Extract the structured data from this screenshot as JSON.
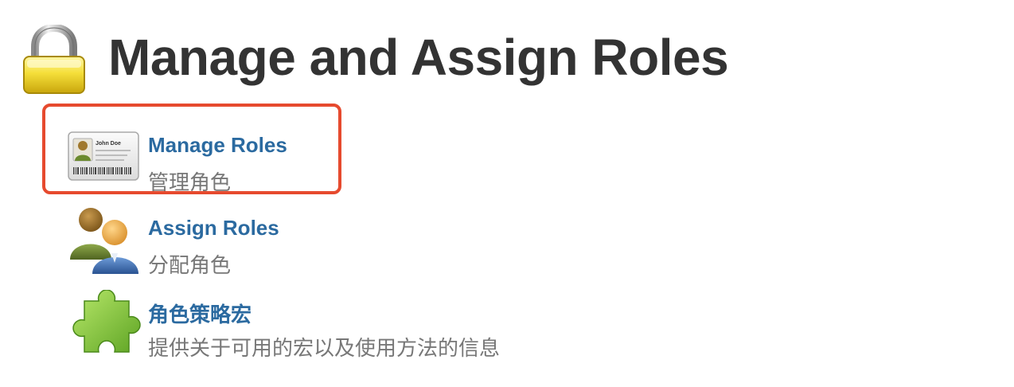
{
  "header": {
    "title": "Manage and Assign Roles",
    "icon": "lock-icon"
  },
  "items": [
    {
      "link": "Manage Roles",
      "description": "管理角色",
      "icon": "id-card-icon",
      "card_name": "John Doe",
      "highlighted": true
    },
    {
      "link": "Assign Roles",
      "description": "分配角色",
      "icon": "users-icon",
      "highlighted": false
    },
    {
      "link": "角色策略宏",
      "description": "提供关于可用的宏以及使用方法的信息",
      "icon": "puzzle-piece-icon",
      "highlighted": false
    }
  ],
  "colors": {
    "link": "#2b6aa0",
    "title": "#333333",
    "description": "#777777",
    "highlight_border": "#e64a2e"
  }
}
